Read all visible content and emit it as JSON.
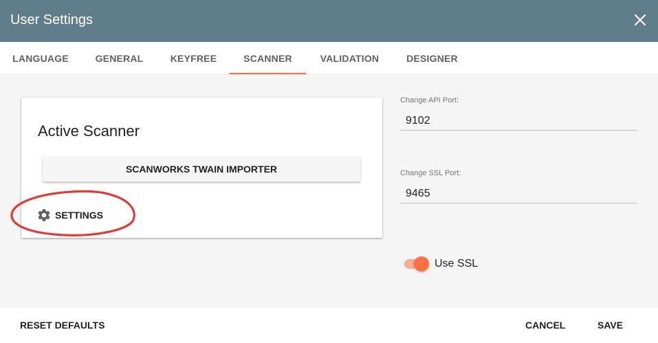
{
  "dialog": {
    "title": "User Settings",
    "close_icon": "close-icon"
  },
  "tabs": [
    {
      "label": "LANGUAGE",
      "active": false
    },
    {
      "label": "GENERAL",
      "active": false
    },
    {
      "label": "KEYFREE",
      "active": false
    },
    {
      "label": "SCANNER",
      "active": true
    },
    {
      "label": "VALIDATION",
      "active": false
    },
    {
      "label": "DESIGNER",
      "active": false
    }
  ],
  "scanner_card": {
    "title": "Active Scanner",
    "scanner_button_label": "SCANWORKS TWAIN IMPORTER",
    "settings_label": "SETTINGS",
    "settings_icon": "gear-icon"
  },
  "ports": {
    "api_label": "Change API Port:",
    "api_value": "9102",
    "ssl_label": "Change SSL Port:",
    "ssl_value": "9465"
  },
  "ssl_toggle": {
    "label": "Use SSL",
    "checked": true
  },
  "footer": {
    "reset_label": "RESET DEFAULTS",
    "cancel_label": "CANCEL",
    "save_label": "SAVE"
  },
  "colors": {
    "header": "#607d8b",
    "accent": "#ff7043",
    "annotation": "#e53935"
  }
}
